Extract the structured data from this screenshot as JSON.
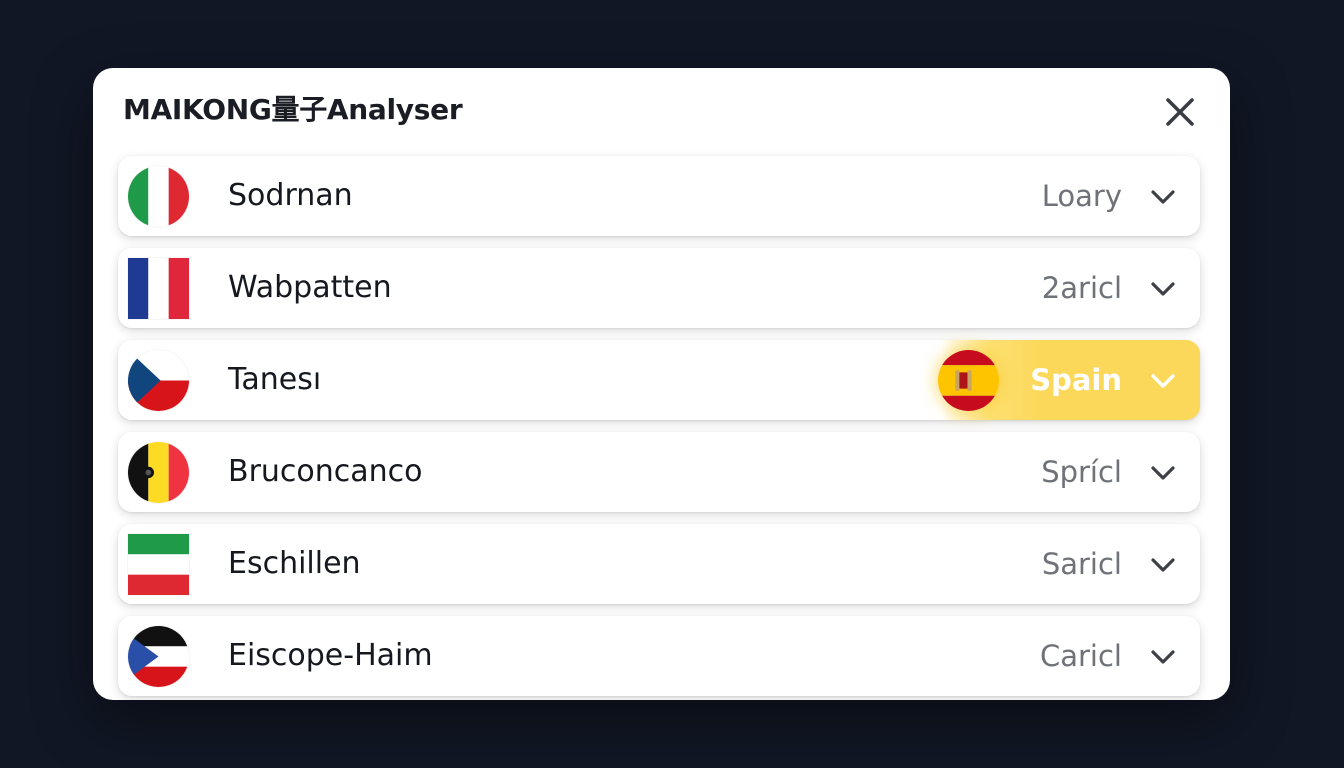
{
  "dialog": {
    "title": "MAIKONG量子Analyser",
    "close_icon": "close-icon"
  },
  "rows": [
    {
      "label": "Sodrnan",
      "value": "Loary",
      "flag": "italy-flag-icon"
    },
    {
      "label": "Wabpatten",
      "value": "2aricl",
      "flag": "france-flag-icon"
    },
    {
      "label": "Tanesı",
      "value": "Spain",
      "flag": "czech-flag-icon",
      "selected": true,
      "selected_flag": "spain-flag-icon"
    },
    {
      "label": "Bruconcanco",
      "value": "Sprícl",
      "flag": "belgium-flag-icon"
    },
    {
      "label": "Eschillen",
      "value": "Saricl",
      "flag": "italy-stripes-flag-icon"
    },
    {
      "label": "Eiscope-Haim",
      "value": "Caricl",
      "flag": "tricolor-triangle-flag-icon"
    }
  ],
  "colors": {
    "background": "#111725",
    "highlight": "#fcd85a",
    "text": "#15181e",
    "muted": "#6f7278"
  }
}
